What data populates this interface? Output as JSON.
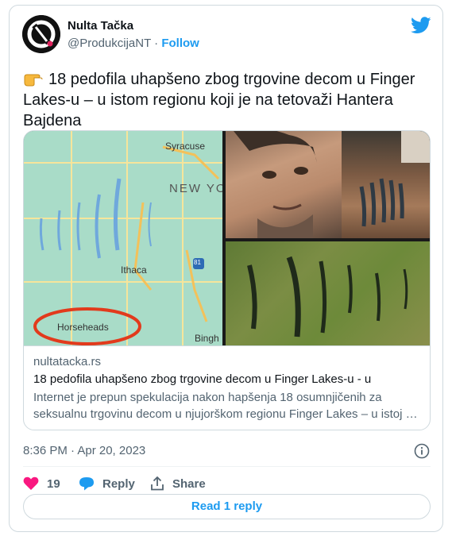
{
  "author": {
    "name": "Nulta Tačka",
    "handle": "@ProdukcijaNT",
    "separator": "·",
    "follow_label": "Follow",
    "avatar_icon": "nulta-tacka-logo-icon"
  },
  "brand": {
    "icon": "twitter-bird-icon",
    "color": "#1d9bf0"
  },
  "tweet": {
    "emoji_icon": "pointing-hand-icon",
    "text": "18 pedofila uhapšeno zbog trgovine decom u Finger Lakes-u – u istom regionu koji je na tetovaži Hantera Bajdena"
  },
  "card": {
    "image": {
      "map_labels": {
        "syracuse": "Syracuse",
        "new_york": "NEW YO",
        "ithaca": "Ithaca",
        "horseheads": "Horseheads",
        "bingh": "Bingh",
        "shield": "81"
      }
    },
    "domain": "nultatacka.rs",
    "title": "18 pedofila uhapšeno zbog trgovine decom u Finger Lakes-u - u",
    "description": "Internet je prepun spekulacija nakon hapšenja 18 osumnjičenih za seksualnu trgovinu decom u njujorškom regionu Finger Lakes – u istoj …"
  },
  "meta": {
    "timestamp": "8:36 PM · Apr 20, 2023",
    "info_icon": "info-icon"
  },
  "actions": {
    "like_count": "19",
    "like_color": "#f91880",
    "reply_label": "Reply",
    "share_label": "Share"
  },
  "read_reply_label": "Read 1 reply"
}
